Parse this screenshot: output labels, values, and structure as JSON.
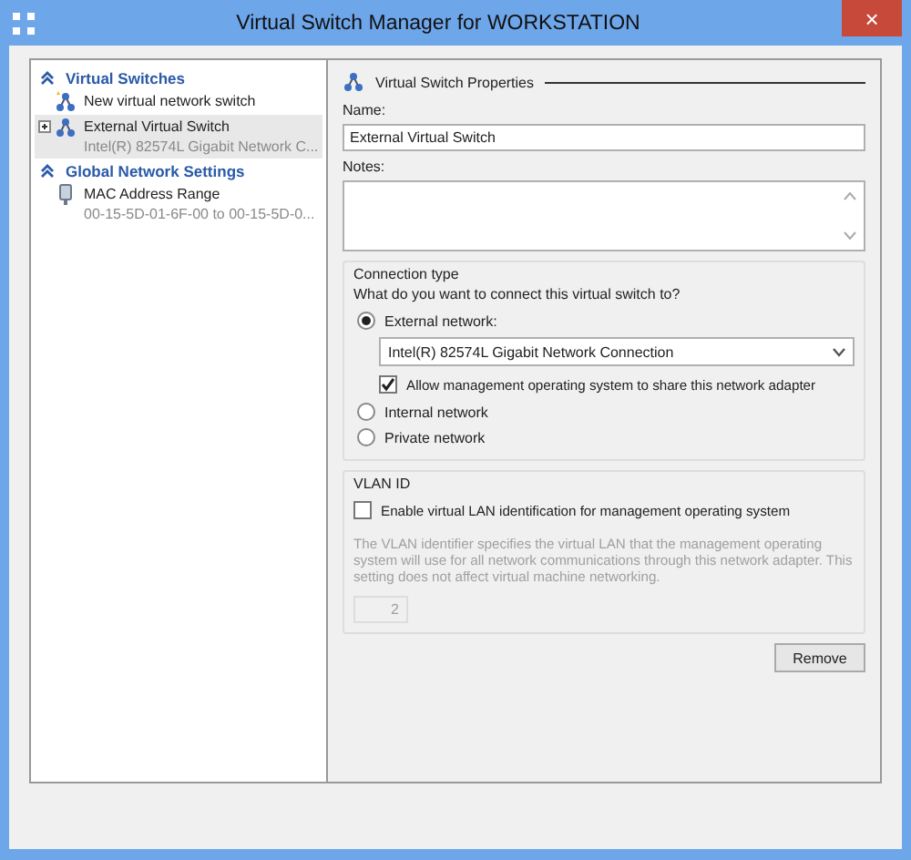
{
  "window": {
    "title": "Virtual Switch Manager for WORKSTATION",
    "close": "×"
  },
  "sidebar": {
    "sections": [
      {
        "title": "Virtual Switches",
        "expanded": true,
        "items": [
          {
            "kind": "new",
            "label": "New virtual network switch",
            "selected": false,
            "expandable": false
          },
          {
            "kind": "switch",
            "label": "External Virtual Switch",
            "sub": "Intel(R) 82574L Gigabit Network C...",
            "selected": true,
            "expandable": true
          }
        ]
      },
      {
        "title": "Global Network Settings",
        "expanded": true,
        "items": [
          {
            "kind": "mac",
            "label": "MAC Address Range",
            "sub": "00-15-5D-01-6F-00 to 00-15-5D-0...",
            "selected": false,
            "expandable": false
          }
        ]
      }
    ]
  },
  "properties": {
    "heading": "Virtual Switch Properties",
    "name_label": "Name:",
    "name_value": "External Virtual Switch",
    "notes_label": "Notes:",
    "connection": {
      "title": "Connection type",
      "question": "What do you want to connect this virtual switch to?",
      "options": [
        {
          "label": "External network:",
          "selected": true
        },
        {
          "label": "Internal network",
          "selected": false
        },
        {
          "label": "Private network",
          "selected": false
        }
      ],
      "adapter": "Intel(R) 82574L Gigabit Network Connection",
      "share": {
        "label": "Allow management operating system to share this network adapter",
        "checked": true
      }
    },
    "vlan": {
      "title": "VLAN ID",
      "enable": {
        "label": "Enable virtual LAN identification for management operating system",
        "checked": false
      },
      "description": "The VLAN identifier specifies the virtual LAN that the management operating system will use for all network communications through this network adapter. This setting does not affect virtual machine networking.",
      "value": "2"
    },
    "remove": "Remove"
  }
}
